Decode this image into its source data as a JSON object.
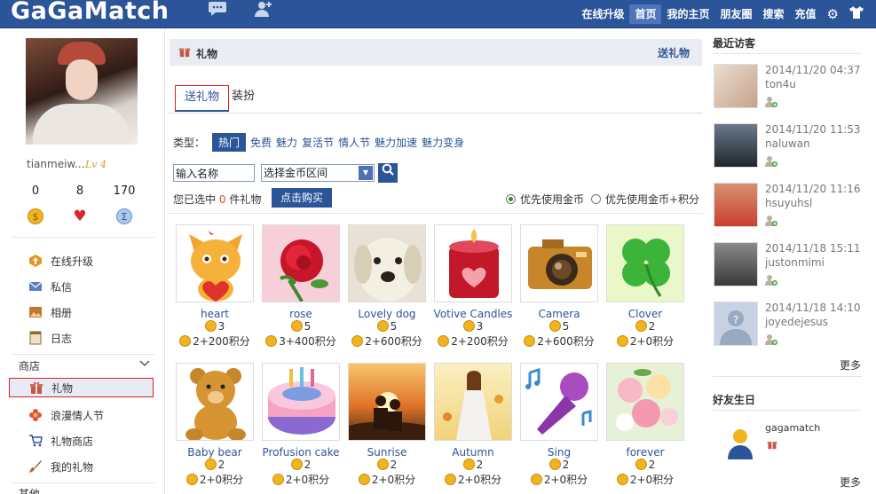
{
  "topbar": {
    "logo": "GaGaMatch",
    "nav": [
      "在线升级",
      "首页",
      "我的主页",
      "朋友圈",
      "搜索",
      "充值"
    ],
    "active_nav": "首页",
    "icons": [
      "chat-icon",
      "add-user-icon",
      "gear-icon",
      "shirt-icon"
    ]
  },
  "profile": {
    "username": "tianmeiw...",
    "level": "Lv 4",
    "stats": [
      {
        "value": "0",
        "icon": "coin-icon"
      },
      {
        "value": "8",
        "icon": "heart-icon"
      },
      {
        "value": "170",
        "icon": "points-icon"
      }
    ]
  },
  "sidebar": {
    "items": [
      {
        "label": "在线升级",
        "icon": "upgrade-icon"
      },
      {
        "label": "私信",
        "icon": "mail-icon"
      },
      {
        "label": "相册",
        "icon": "photo-icon"
      },
      {
        "label": "日志",
        "icon": "journal-icon"
      }
    ],
    "shop_label": "商店",
    "shop_items": [
      {
        "label": "礼物",
        "icon": "gift-icon",
        "selected": true
      },
      {
        "label": "浪漫情人节",
        "icon": "flower-icon"
      },
      {
        "label": "礼物商店",
        "icon": "cart-icon"
      },
      {
        "label": "我的礼物",
        "icon": "brush-icon"
      }
    ],
    "other_label": "其他"
  },
  "main": {
    "header_title": "礼物",
    "header_action": "送礼物",
    "tabs": [
      "送礼物",
      "装扮"
    ],
    "type_label": "类型：",
    "types": [
      "热门",
      "免费",
      "魅力",
      "复活节",
      "情人节",
      "魅力加速",
      "魅力变身"
    ],
    "active_type": "热门",
    "name_input": "输入名称",
    "coin_select": "选择金币区间",
    "selected_prefix": "您已选中",
    "selected_count": "0",
    "selected_suffix": "件礼物",
    "buy_button": "点击购买",
    "radio_coins": "优先使用金币",
    "radio_coins_points": "优先使用金币+积分"
  },
  "gifts": [
    {
      "name": "heart",
      "coins": "3",
      "alt": "2+200积分"
    },
    {
      "name": "rose",
      "coins": "5",
      "alt": "3+400积分"
    },
    {
      "name": "Lovely dog",
      "coins": "5",
      "alt": "2+600积分"
    },
    {
      "name": "Votive Candles",
      "coins": "3",
      "alt": "2+200积分"
    },
    {
      "name": "Camera",
      "coins": "5",
      "alt": "2+600积分"
    },
    {
      "name": "Clover",
      "coins": "2",
      "alt": "2+0积分"
    },
    {
      "name": "Baby bear",
      "coins": "2",
      "alt": "2+0积分"
    },
    {
      "name": "Profusion cake",
      "coins": "2",
      "alt": "2+0积分"
    },
    {
      "name": "Sunrise",
      "coins": "2",
      "alt": "2+0积分"
    },
    {
      "name": "Autumn",
      "coins": "2",
      "alt": "2+0积分"
    },
    {
      "name": "Sing",
      "coins": "2",
      "alt": "2+0积分"
    },
    {
      "name": "forever",
      "coins": "2",
      "alt": "2+0积分"
    }
  ],
  "colors": {
    "brand": "#2c5499",
    "highlight_box": "#e21e1e",
    "count": "#e04c2b"
  },
  "visitors_title": "最近访客",
  "visitors": [
    {
      "date": "2014/11/20 04:37",
      "name": "ton4u"
    },
    {
      "date": "2014/11/20 11:53",
      "name": "naluwan"
    },
    {
      "date": "2014/11/20 11:16",
      "name": "hsuyuhsl"
    },
    {
      "date": "2014/11/18 15:11",
      "name": "justonmimi"
    },
    {
      "date": "2014/11/18 14:10",
      "name": "joyedejesus"
    }
  ],
  "more": "更多",
  "birthday_title": "好友生日",
  "birthday_name": "gagamatch",
  "birthday_more": "更多"
}
